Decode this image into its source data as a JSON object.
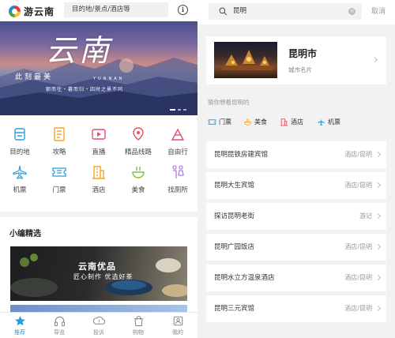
{
  "left": {
    "logo_text": "游云南",
    "search_placeholder": "目的地/景点/酒店等",
    "banner": {
      "title": "云南",
      "subtitle": "此刻最美",
      "pinyin": "YUNNAN",
      "tagline": "朝而往・暮而归・四时之景不同"
    },
    "grid": [
      {
        "label": "目的地",
        "icon": "destination-icon",
        "color": "#2d9cdb"
      },
      {
        "label": "攻略",
        "icon": "guide-icon",
        "color": "#f5a623"
      },
      {
        "label": "直播",
        "icon": "live-icon",
        "color": "#e94b6a"
      },
      {
        "label": "精品线路",
        "icon": "route-icon",
        "color": "#e94b6a"
      },
      {
        "label": "自由行",
        "icon": "free-travel-icon",
        "color": "#e94b6a"
      },
      {
        "label": "机票",
        "icon": "plane-icon",
        "color": "#2d9cdb"
      },
      {
        "label": "门票",
        "icon": "ticket-icon",
        "color": "#2d9cdb"
      },
      {
        "label": "酒店",
        "icon": "hotel-icon",
        "color": "#f5a623"
      },
      {
        "label": "美食",
        "icon": "food-icon",
        "color": "#7cc242"
      },
      {
        "label": "找厕所",
        "icon": "restroom-icon",
        "color": "#b57edc"
      }
    ],
    "section_title": "小编精选",
    "card": {
      "title": "云南优品",
      "subtitle": "匠心制作 优选好茶"
    },
    "tabs": [
      {
        "label": "推荐",
        "icon": "star-icon",
        "active": true
      },
      {
        "label": "导览",
        "icon": "headphones-icon",
        "active": false
      },
      {
        "label": "投诉",
        "icon": "complaint-icon",
        "active": false
      },
      {
        "label": "购物",
        "icon": "shopping-bag-icon",
        "active": false
      },
      {
        "label": "我的",
        "icon": "profile-icon",
        "active": false
      }
    ]
  },
  "right": {
    "search_value": "昆明",
    "cancel_label": "取消",
    "city": {
      "name": "昆明市",
      "subtitle": "城市名片"
    },
    "guess_label": "猜你想看昆明的",
    "chips": [
      {
        "label": "门票",
        "icon": "ticket-icon",
        "color": "#2d9cdb"
      },
      {
        "label": "美食",
        "icon": "food-icon",
        "color": "#f5a623"
      },
      {
        "label": "酒店",
        "icon": "hotel-icon",
        "color": "#e94b6a"
      },
      {
        "label": "机票",
        "icon": "plane-icon",
        "color": "#2d9cdb"
      }
    ],
    "results": [
      {
        "name": "昆明昆铁房建宾馆",
        "type": "酒店/昆明"
      },
      {
        "name": "昆明大生宾馆",
        "type": "酒店/昆明"
      },
      {
        "name": "探访昆明老街",
        "type": "游记"
      },
      {
        "name": "昆明广园饭店",
        "type": "酒店/昆明"
      },
      {
        "name": "昆明水立方温泉酒店",
        "type": "酒店/昆明"
      },
      {
        "name": "昆明三元宾馆",
        "type": "酒店/昆明"
      }
    ]
  }
}
